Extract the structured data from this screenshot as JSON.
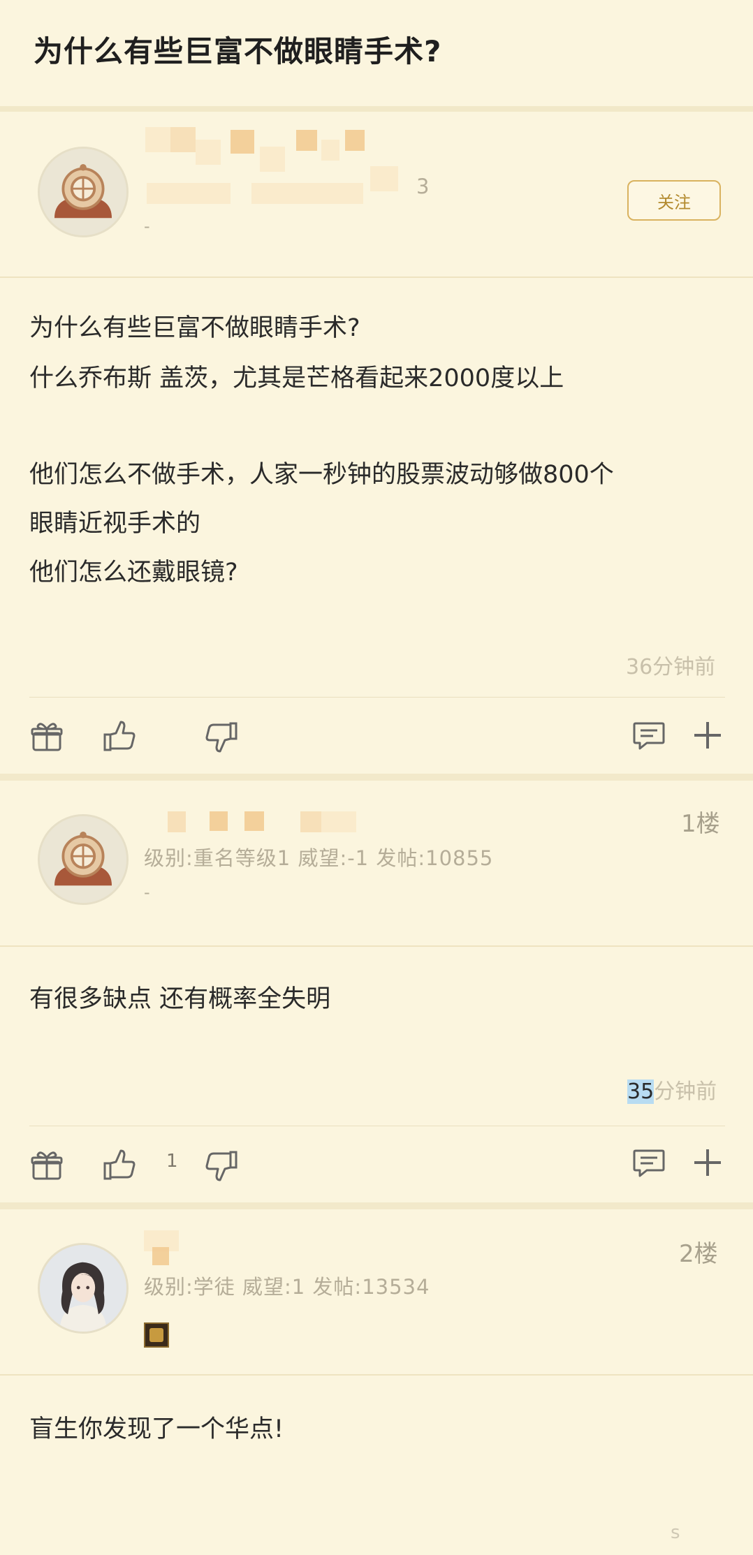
{
  "header": {
    "title": "为什么有些巨富不做眼睛手术?"
  },
  "colors": {
    "background": "#fbf5de",
    "accent": "#d9b25f",
    "muted_text": "#b5ad98"
  },
  "original_post": {
    "user_meta_suffix": "3",
    "meta_dash": "-",
    "follow_label": "关注",
    "body_lines": [
      "为什么有些巨富不做眼睛手术?",
      "什么乔布斯 盖茨，尤其是芒格看起来2000度以上",
      "",
      "他们怎么不做手术，人家一秒钟的股票波动够做800个",
      "眼睛近视手术的",
      "他们怎么还戴眼镜?"
    ],
    "time": "36分钟前",
    "actions": {
      "gift_icon": "gift-icon",
      "like_icon": "thumbs-up-icon",
      "dislike_icon": "thumbs-down-icon",
      "comment_icon": "comment-icon",
      "more_icon": "plus-icon"
    }
  },
  "replies": [
    {
      "floor": "1楼",
      "meta": "级别:重名等级1 威望:-1 发帖:10855",
      "meta_dash": "-",
      "body": "有很多缺点 还有概率全失明",
      "time_highlight": "35",
      "time_rest": "分钟前",
      "like_count": "1"
    },
    {
      "floor": "2楼",
      "meta": "级别:学徒 威望:1 发帖:13534",
      "body": "盲生你发现了一个华点!"
    }
  ],
  "watermark": "s"
}
